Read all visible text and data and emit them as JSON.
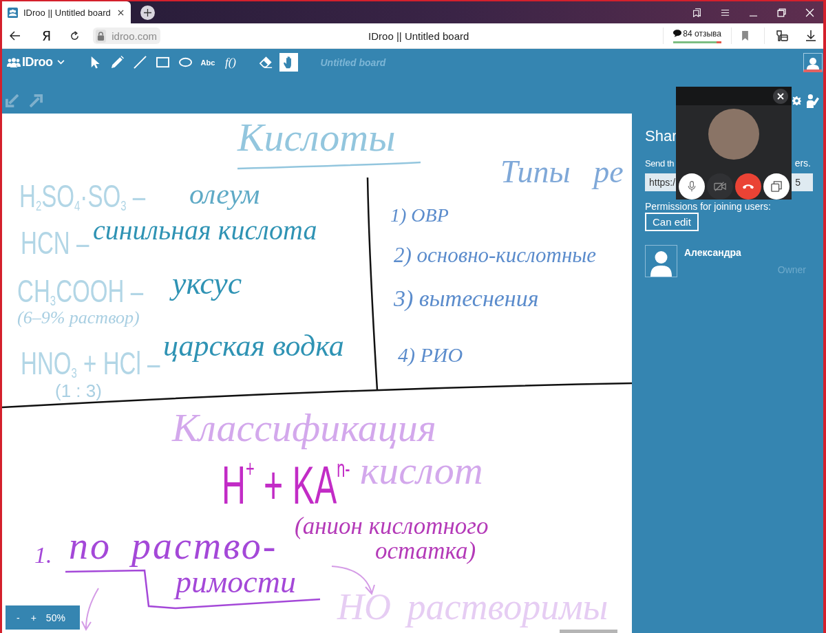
{
  "browser": {
    "tab_title": "IDroo || Untitled board",
    "logo_letter": "Я",
    "address": "idroo.com",
    "page_title": "IDroo || Untitled board",
    "reviews": {
      "label": "84 отзыва",
      "level": 0.9
    }
  },
  "toolbar": {
    "logo": "IDroo",
    "tools": [
      {
        "kind": "select",
        "selected": false
      },
      {
        "kind": "pencil",
        "selected": false
      },
      {
        "kind": "line",
        "selected": false
      },
      {
        "kind": "rectangle",
        "selected": false
      },
      {
        "kind": "ellipse",
        "selected": false
      },
      {
        "kind": "text",
        "label": "Abc",
        "selected": false
      },
      {
        "kind": "formula",
        "label": "f()",
        "selected": false
      },
      {
        "kind": "eraser",
        "selected": false
      },
      {
        "kind": "hand",
        "selected": true
      }
    ],
    "board_title": "Untitled board"
  },
  "board": {
    "title": "Кислоты",
    "acids": [
      {
        "formula": "H$_{2}$SO$_{4}$·SO$_{3}$ –",
        "name": "олеум"
      },
      {
        "formula": "HCN –",
        "name": "синильная кислота"
      },
      {
        "formula": "CH$_{3}$COOH –",
        "name": "уксус",
        "note": "(6–9% раствор)"
      },
      {
        "formula": "HNO$_{3}$ + HCl –",
        "name": "царская водка",
        "note": "(1 : 3)"
      }
    ],
    "reaction_types": {
      "title": "Типы ре",
      "items": [
        "1) ОВР",
        "2) основно-кислотные",
        "3) вытеснения",
        "4) РИО"
      ]
    },
    "classification": {
      "title": [
        "Классификация",
        "кислот"
      ],
      "formula": "H$^{+}$ + KA$^{n-}$",
      "formula_note": [
        "(анион кислотного",
        "остатка)"
      ],
      "criterion_number": "1.",
      "criterion": [
        "по раство-",
        "римости"
      ],
      "branch": "HO растворимы"
    }
  },
  "zoom": {
    "out": "-",
    "in": "+",
    "value": "50%"
  },
  "share_panel": {
    "heading": "Shar",
    "instruction_start": "Send th",
    "instruction_end": "ers.",
    "link_start": "https:/",
    "link_end": "5",
    "permissions_label": "Permissions for joining users:",
    "permission": "Can edit",
    "users": [
      {
        "name": "Александра",
        "role": "Owner"
      }
    ]
  },
  "video_call": {
    "controls": [
      {
        "kind": "microphone"
      },
      {
        "kind": "camera",
        "on": false
      },
      {
        "kind": "hangup"
      },
      {
        "kind": "windows"
      }
    ]
  }
}
